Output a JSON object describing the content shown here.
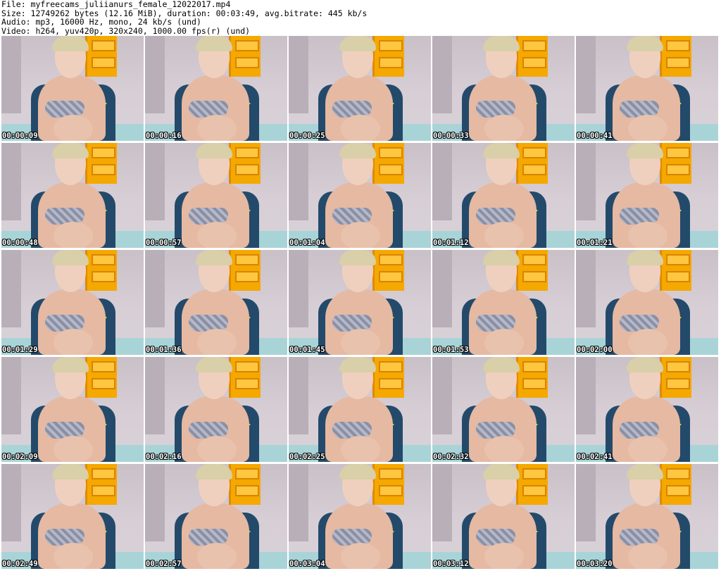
{
  "header": {
    "file_line": "File: myfreecams_juliianurs_female_12022017.mp4",
    "size_line": "Size: 12749262 bytes (12.16 MiB), duration: 00:03:49, avg.bitrate: 445 kb/s",
    "audio_line": "Audio: mp3, 16000 Hz, mono, 24 kb/s (und)",
    "video_line": "Video: h264, yuv420p, 320x240, 1000.00 fps(r) (und)"
  },
  "thumbnails": [
    {
      "timestamp": "00:00:09"
    },
    {
      "timestamp": "00:00:16"
    },
    {
      "timestamp": "00:00:25"
    },
    {
      "timestamp": "00:00:33"
    },
    {
      "timestamp": "00:00:41"
    },
    {
      "timestamp": "00:00:48"
    },
    {
      "timestamp": "00:00:57"
    },
    {
      "timestamp": "00:01:04"
    },
    {
      "timestamp": "00:01:12"
    },
    {
      "timestamp": "00:01:21"
    },
    {
      "timestamp": "00:01:29"
    },
    {
      "timestamp": "00:01:36"
    },
    {
      "timestamp": "00:01:45"
    },
    {
      "timestamp": "00:01:53"
    },
    {
      "timestamp": "00:02:00"
    },
    {
      "timestamp": "00:02:09"
    },
    {
      "timestamp": "00:02:16"
    },
    {
      "timestamp": "00:02:25"
    },
    {
      "timestamp": "00:02:32"
    },
    {
      "timestamp": "00:02:41"
    },
    {
      "timestamp": "00:02:49"
    },
    {
      "timestamp": "00:02:57"
    },
    {
      "timestamp": "00:03:04"
    },
    {
      "timestamp": "00:03:12"
    },
    {
      "timestamp": "00:03:20"
    }
  ]
}
